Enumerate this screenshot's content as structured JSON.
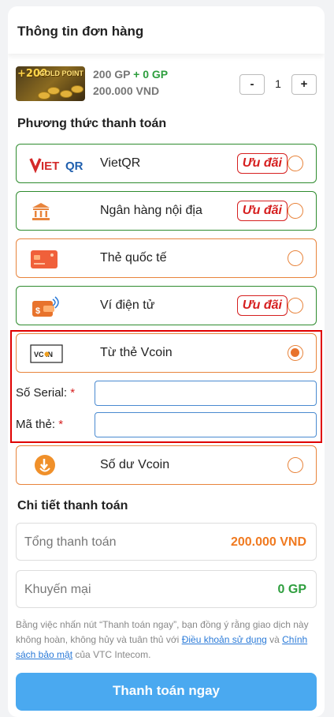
{
  "header": {
    "title": "Thông tin đơn hàng"
  },
  "product": {
    "thumb_text_amount": "+200",
    "thumb_text_name": "GOLD POINT",
    "gp_base": "200 GP",
    "gp_bonus": "+ 0 GP",
    "price": "200.000 VND",
    "minus_label": "-",
    "quantity": "1",
    "plus_label": "+"
  },
  "payment": {
    "title": "Phương thức thanh toán",
    "methods": [
      {
        "label": "VietQR",
        "icon": "vietqr-logo",
        "badge": "Ưu đãi",
        "selected": false
      },
      {
        "label": "Ngân hàng nội địa",
        "icon": "bank-icon",
        "badge": "Ưu đãi",
        "selected": false
      },
      {
        "label": "Thẻ quốc tế",
        "icon": "credit-card-icon",
        "badge": "",
        "selected": false
      },
      {
        "label": "Ví điện tử",
        "icon": "e-wallet-icon",
        "badge": "Ưu đãi",
        "selected": false
      },
      {
        "label": "Từ thẻ Vcoin",
        "icon": "vcoin-logo",
        "badge": "",
        "selected": true
      },
      {
        "label": "Số dư Vcoin",
        "icon": "vcoin-balance-icon",
        "badge": "",
        "selected": false
      }
    ],
    "vcoin_logo_text": "VC IN",
    "serial_label": "Số Serial:",
    "code_label": "Mã thẻ:",
    "required_mark": "*",
    "serial_value": "",
    "code_value": ""
  },
  "details": {
    "title": "Chi tiết thanh toán",
    "total_label": "Tổng thanh toán",
    "total_value": "200.000 VND",
    "promo_label": "Khuyến mại",
    "promo_value": "0 GP"
  },
  "terms": {
    "text_before": "Bằng việc nhấn nút “Thanh toán ngay”, bạn đồng ý rằng giao dịch này không hoàn, không hủy và tuân thủ với ",
    "link_terms": "Điều khoản sử dụng",
    "text_middle": " và ",
    "link_privacy": "Chính sách bảo mật",
    "text_after": " của VTC Intecom."
  },
  "pay_button": "Thanh toán ngay",
  "colors": {
    "accent_orange": "#e8843c",
    "green_border": "#2e8b2e",
    "badge_red": "#d62020",
    "total_orange": "#f07a20",
    "promo_green": "#2e9e3e",
    "pay_blue": "#4aa9f0"
  }
}
